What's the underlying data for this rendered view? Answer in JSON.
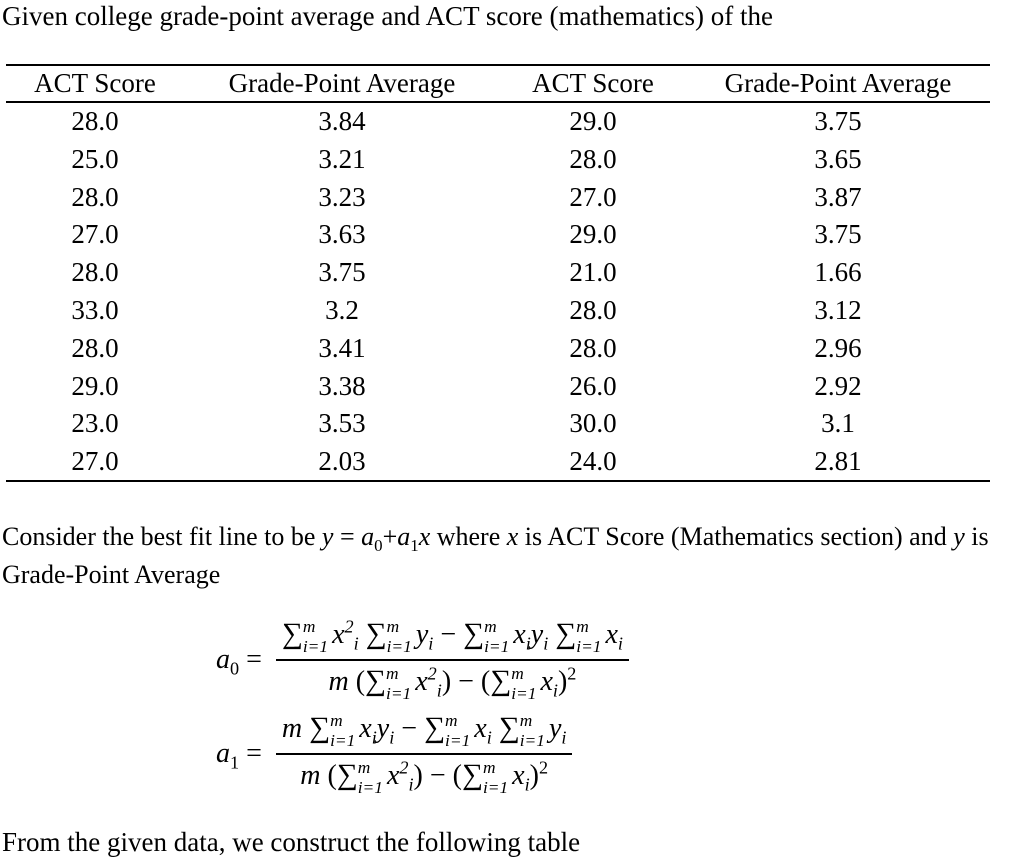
{
  "intro": "Given college grade-point average and ACT score (mathematics) of the",
  "table": {
    "headers": [
      "ACT Score",
      "Grade-Point Average",
      "ACT Score",
      "Grade-Point Average"
    ],
    "rows": [
      [
        "28.0",
        "3.84",
        "29.0",
        "3.75"
      ],
      [
        "25.0",
        "3.21",
        "28.0",
        "3.65"
      ],
      [
        "28.0",
        "3.23",
        "27.0",
        "3.87"
      ],
      [
        "27.0",
        "3.63",
        "29.0",
        "3.75"
      ],
      [
        "28.0",
        "3.75",
        "21.0",
        "1.66"
      ],
      [
        "33.0",
        "3.2",
        "28.0",
        "3.12"
      ],
      [
        "28.0",
        "3.41",
        "28.0",
        "2.96"
      ],
      [
        "29.0",
        "3.38",
        "26.0",
        "2.92"
      ],
      [
        "23.0",
        "3.53",
        "30.0",
        "3.1"
      ],
      [
        "27.0",
        "2.03",
        "24.0",
        "2.81"
      ]
    ]
  },
  "consider": {
    "part1": "Consider the best fit line to be ",
    "equation": "y = a0+a1x",
    "part2": " where ",
    "x_var": "x",
    "part3": " is ACT Score (Mathematics section) and ",
    "y_var": "y",
    "part4": " is Grade-Point Average"
  },
  "formulas": {
    "a0": {
      "lhs": "a0 =",
      "numerator": "Σ(i=1..m) xi² Σ(i=1..m) yi − Σ(i=1..m) xi yi Σ(i=1..m) xi",
      "denominator": "m (Σ(i=1..m) xi²) − (Σ(i=1..m) xi)²"
    },
    "a1": {
      "lhs": "a1 =",
      "numerator": "m Σ(i=1..m) xi yi − Σ(i=1..m) xi Σ(i=1..m) yi",
      "denominator": "m (Σ(i=1..m) xi²) − (Σ(i=1..m) xi)²"
    }
  },
  "outro": "From the given data, we construct the following table"
}
